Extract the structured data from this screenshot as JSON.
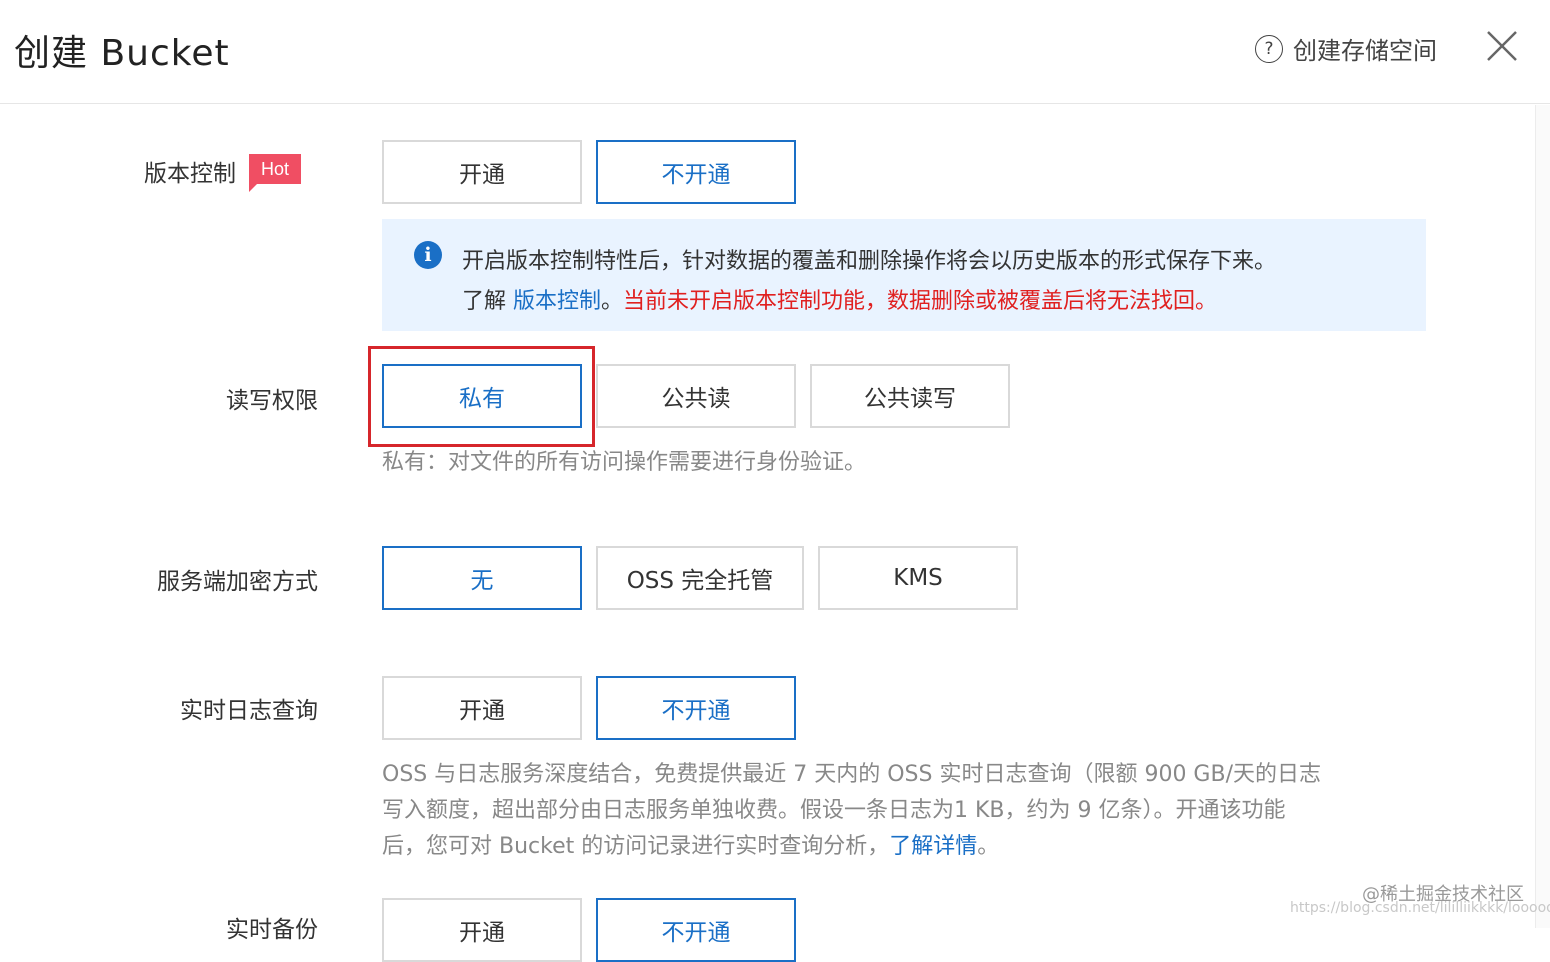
{
  "header": {
    "title": "创建 Bucket",
    "help_label": "创建存储空间"
  },
  "versioning": {
    "label": "版本控制",
    "badge": "Hot",
    "options": [
      "开通",
      "不开通"
    ],
    "selected": "不开通",
    "info_line1": "开启版本控制特性后，针对数据的覆盖和删除操作将会以历史版本的形式保存下来。",
    "info_prefix": "了解",
    "info_link": "版本控制",
    "info_sep": "。",
    "info_warning": "当前未开启版本控制功能，数据删除或被覆盖后将无法找回。"
  },
  "acl": {
    "label": "读写权限",
    "options": [
      "私有",
      "公共读",
      "公共读写"
    ],
    "selected": "私有",
    "description": "私有：对文件的所有访问操作需要进行身份验证。"
  },
  "encryption": {
    "label": "服务端加密方式",
    "options": [
      "无",
      "OSS 完全托管",
      "KMS"
    ],
    "selected": "无"
  },
  "realtime_log": {
    "label": "实时日志查询",
    "options": [
      "开通",
      "不开通"
    ],
    "selected": "不开通",
    "desc_line1": "OSS 与日志服务深度结合，免费提供最近 7 天内的 OSS 实时日志查询（限额 900 GB/天的日志",
    "desc_line2": "写入额度，超出部分由日志服务单独收费。假设一条日志为1 KB，约为 9 亿条）。开通该功能",
    "desc_line3_prefix": "后，您可对 Bucket 的访问记录进行实时查询分析，",
    "desc_link": "了解详情",
    "desc_end": "。"
  },
  "backup": {
    "label": "实时备份",
    "options": [
      "开通",
      "不开通"
    ],
    "selected": "不开通"
  },
  "watermark": {
    "line1": "@稀土掘金技术社区",
    "line2": "https://blog.csdn.net/lililliikkkk/looooo"
  },
  "colors": {
    "accent": "#1a6fc6",
    "warning": "#e02020",
    "hot_badge": "#f04e63",
    "highlight_box": "#d6262b",
    "info_bg": "#e9f3ff"
  }
}
